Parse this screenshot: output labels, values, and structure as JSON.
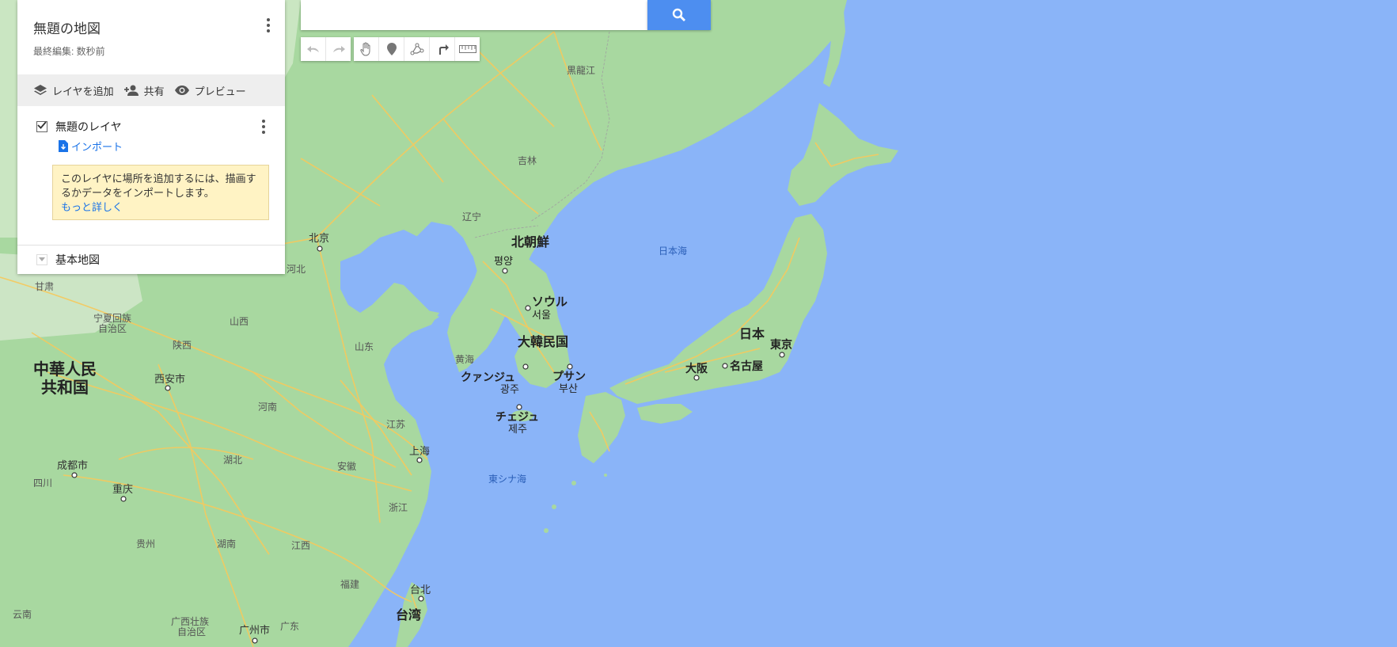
{
  "panel": {
    "title": "無題の地図",
    "last_edited": "最終編集: 数秒前",
    "add_layer_label": "レイヤを追加",
    "share_label": "共有",
    "preview_label": "プレビュー",
    "layer_name": "無題のレイヤ",
    "import_label": "インポート",
    "hint_text": "このレイヤに場所を追加するには、描画するかデータをインポートします。",
    "learn_more": "もっと詳しく",
    "base_map_label": "基本地図"
  },
  "search": {
    "placeholder": "",
    "value": ""
  },
  "toolbar": [
    "undo-icon",
    "redo-icon",
    "hand-icon",
    "marker-icon",
    "draw-line-icon",
    "directions-icon",
    "ruler-icon"
  ],
  "colors": {
    "water": "#8ab4f8",
    "land": "#a8d8a0",
    "land_light": "#d8ecd0",
    "road": "#f7c95c",
    "accent": "#4d8ef0",
    "link": "#1a73e8",
    "hint_bg": "#fff3c4"
  },
  "map": {
    "labels": {
      "heilongjiang": "黒龍江",
      "jilin": "吉林",
      "liaoning": "辽宁",
      "beijing": "北京",
      "hebei": "河北",
      "gansu": "甘肃",
      "ningxia": "宁夏回族",
      "ningxia2": "自治区",
      "shaanxi": "陕西",
      "shanxi": "山西",
      "shandong": "山东",
      "china1": "中華人民",
      "china2": "共和国",
      "xian": "西安市",
      "henan": "河南",
      "jiangsu": "江苏",
      "shanghai": "上海",
      "anhui": "安徽",
      "hubei": "湖北",
      "chengdu": "成都市",
      "sichuan": "四川",
      "chongqing": "重庆",
      "zhejiang": "浙江",
      "guizhou": "贵州",
      "hunan": "湖南",
      "jiangxi": "江西",
      "fujian": "福建",
      "yunnan": "云南",
      "guangxi": "广西壮族",
      "guangxi2": "自治区",
      "guangzhou": "广州市",
      "guangdong": "广东",
      "taipei": "台北",
      "taiwan": "台湾",
      "northkorea": "北朝鮮",
      "pyongyang": "평양",
      "seoul": "ソウル",
      "seoul2": "서울",
      "southkorea": "大韓民国",
      "yellowsea": "黄海",
      "gwangju": "クァンジュ",
      "gwangju2": "광주",
      "busan": "プサン",
      "busan2": "부산",
      "jeju": "チェジュ",
      "jeju2": "제주",
      "seaofjapan": "日本海",
      "eastchinasea": "東シナ海",
      "japan": "日本",
      "tokyo": "東京",
      "osaka": "大阪",
      "nagoya": "名古屋"
    }
  }
}
